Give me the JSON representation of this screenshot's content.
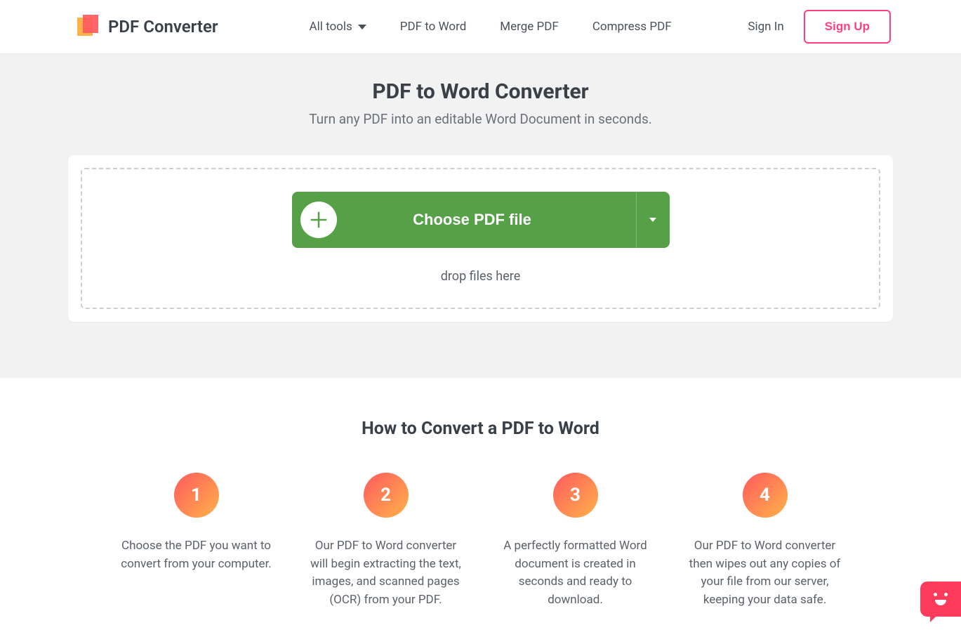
{
  "brand": {
    "name": "PDF Converter"
  },
  "nav": {
    "all_tools": "All tools",
    "pdf_to_word": "PDF to Word",
    "merge_pdf": "Merge PDF",
    "compress_pdf": "Compress PDF"
  },
  "auth": {
    "sign_in": "Sign In",
    "sign_up": "Sign Up"
  },
  "hero": {
    "title": "PDF to Word Converter",
    "subtitle": "Turn any PDF into an editable Word Document in seconds.",
    "choose_label": "Choose PDF file",
    "drop_text": "drop files here"
  },
  "howto": {
    "title": "How to Convert a PDF to Word",
    "steps": [
      {
        "num": "1",
        "text": "Choose the PDF you want to convert from your computer."
      },
      {
        "num": "2",
        "text": "Our PDF to Word converter will begin extracting the text, images, and scanned pages (OCR) from your PDF."
      },
      {
        "num": "3",
        "text": "A perfectly formatted Word document is created in seconds and ready to download."
      },
      {
        "num": "4",
        "text": "Our PDF to Word converter then wipes out any copies of your file from our server, keeping your data safe."
      }
    ]
  },
  "colors": {
    "accent_pink": "#ff3f80",
    "button_green": "#56a048",
    "hero_bg": "#f2f2f2",
    "text_dark": "#394048"
  }
}
